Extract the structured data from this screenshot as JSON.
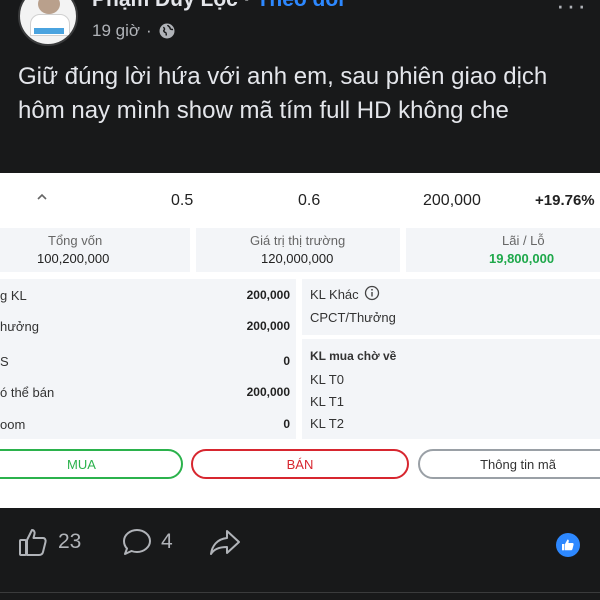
{
  "post": {
    "author": "Phạm Duy Lộc",
    "separator": " · ",
    "follow_label": "Theo dõi",
    "time": "19 giờ",
    "caption": "Giữ đúng lời hứa với anh em, sau phiên giao dịch hôm nay mình show mã tím full HD không che"
  },
  "stock": {
    "row": {
      "v1": "0.5",
      "v2": "0.6",
      "qty": "200,000",
      "pct": "+19.76%"
    },
    "summary": [
      {
        "label": "Tổng vốn",
        "value": "100,200,000"
      },
      {
        "label": "Giá trị thị trường",
        "value": "120,000,000"
      },
      {
        "label": "Lãi / Lỗ",
        "value": "19,800,000"
      }
    ],
    "left_rows": [
      {
        "label": "g KL",
        "value": "200,000"
      },
      {
        "label": "hưởng",
        "value": "200,000"
      },
      {
        "label": "S",
        "value": "0"
      },
      {
        "label": "ó thể bán",
        "value": "200,000"
      },
      {
        "label": "oom",
        "value": "0"
      }
    ],
    "right_top": {
      "kl_khac": "KL Khác",
      "cpct": "CPCT/Thưởng"
    },
    "right_bottom": {
      "title": "KL mua chờ về",
      "t0": "KL T0",
      "t1": "KL T1",
      "t2": "KL T2"
    },
    "buttons": {
      "buy": "MUA",
      "sell": "BÁN",
      "info": "Thông tin mã"
    }
  },
  "footer": {
    "likes": "23",
    "comments": "4"
  },
  "colors": {
    "bg": "#18191a",
    "link": "#2d88ff",
    "green": "#1ea84a",
    "red": "#d7262f"
  }
}
